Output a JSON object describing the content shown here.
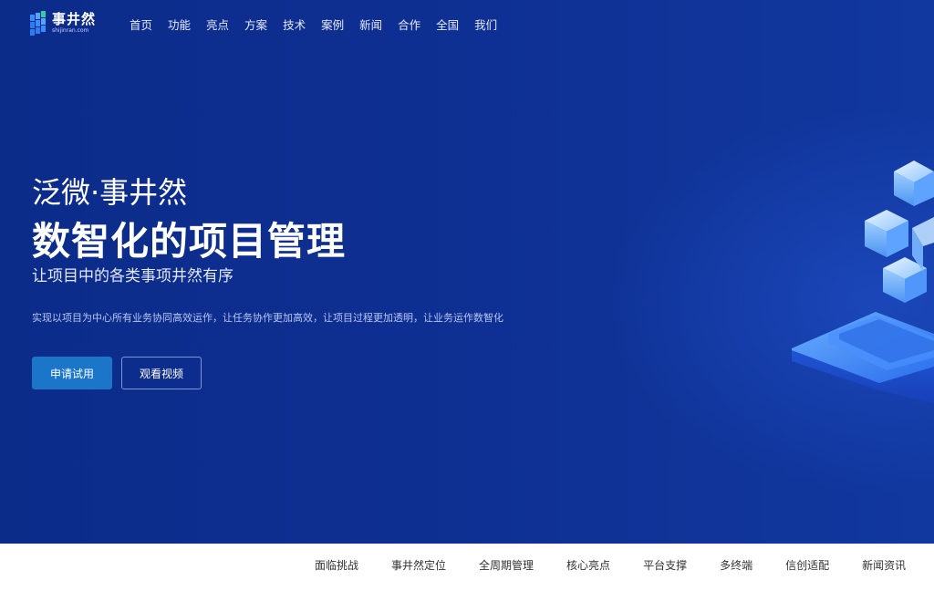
{
  "logo": {
    "title": "事井然",
    "subtitle": "shijinran.com"
  },
  "nav": {
    "items": [
      "首页",
      "功能",
      "亮点",
      "方案",
      "技术",
      "案例",
      "新闻",
      "合作",
      "全国",
      "我们"
    ]
  },
  "hero": {
    "sub_title": "泛微·事井然",
    "main_title": "数智化的项目管理",
    "tagline": "让项目中的各类事项井然有序",
    "description": "实现以项目为中心所有业务协同高效运作，让任务协作更加高效，让项目过程更加透明，让业务运作数智化",
    "primary_button": "申请试用",
    "secondary_button": "观看视频"
  },
  "sub_nav": {
    "items": [
      "面临挑战",
      "事井然定位",
      "全周期管理",
      "核心亮点",
      "平台支撑",
      "多终端",
      "信创适配",
      "新闻资讯"
    ]
  },
  "colors": {
    "hero_background": "#0e2f92",
    "primary_button": "#1b76c9",
    "accent_blue": "#3a8cff"
  },
  "icons": {
    "logo": "grid-logo-icon",
    "illustration": "isometric-cubes-illustration"
  }
}
